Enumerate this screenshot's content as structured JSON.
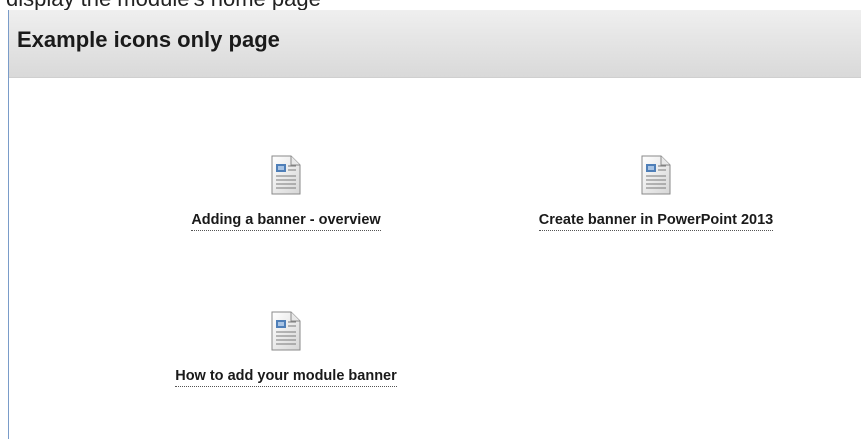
{
  "top_strip_text": "display the module's home page",
  "page_title": "Example icons only page",
  "tiles": [
    {
      "label": "Adding a banner - overview",
      "icon": "document-icon"
    },
    {
      "label": "Create banner in PowerPoint 2013",
      "icon": "document-icon"
    },
    {
      "label": "How to add your module banner",
      "icon": "document-icon"
    }
  ]
}
